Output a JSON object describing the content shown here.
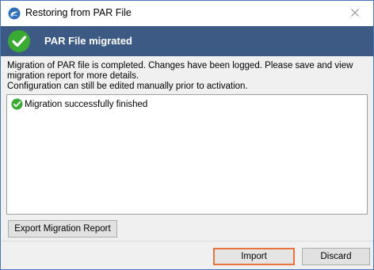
{
  "window": {
    "title": "Restoring from PAR File",
    "app_icon": "app-logo-icon",
    "close_icon": "close-icon"
  },
  "banner": {
    "icon": "check-circle-icon",
    "title": "PAR File migrated",
    "background": "#3d5a85"
  },
  "message": {
    "line1": "Migration of PAR file is completed. Changes have been logged. Please save and view",
    "line2": "migration report for more details.",
    "line3": "Configuration can still be edited manually prior to activation."
  },
  "log": {
    "entries": [
      {
        "icon": "check-circle-icon",
        "text": "Migration successfully finished"
      }
    ]
  },
  "buttons": {
    "export_label": "Export Migration Report",
    "import_label": "Import",
    "discard_label": "Discard"
  },
  "colors": {
    "success": "#3aaa35",
    "focus_outline": "#e8743b"
  }
}
